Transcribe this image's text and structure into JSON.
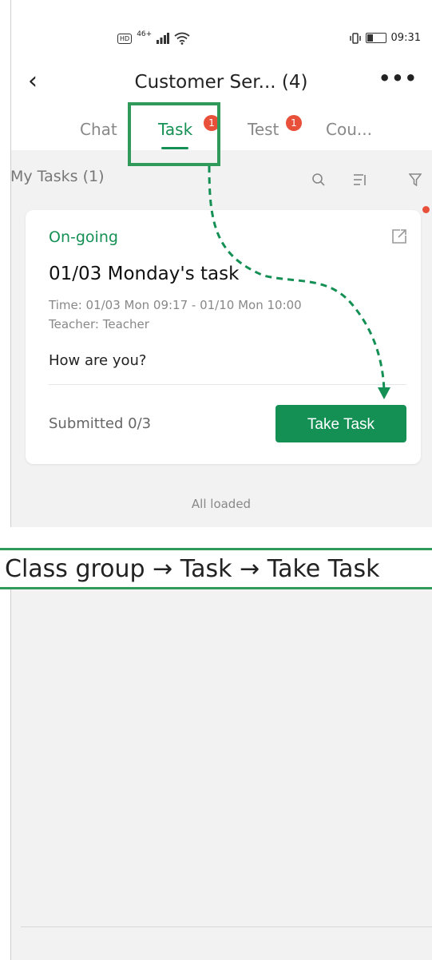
{
  "status_bar": {
    "hd": "HD",
    "network": "46+",
    "time": "09:31"
  },
  "nav": {
    "title": "Customer Ser... (4)",
    "more": "•••"
  },
  "tabs": [
    {
      "label": "Chat"
    },
    {
      "label": "Task",
      "badge": "1"
    },
    {
      "label": "Test",
      "badge": "1"
    },
    {
      "label": "Cou..."
    }
  ],
  "tasks": {
    "label": "My Tasks (1)",
    "card": {
      "status": "On-going",
      "title": "01/03 Monday's task",
      "time": "Time:  01/03 Mon 09:17 - 01/10 Mon 10:00",
      "teacher": "Teacher:  Teacher",
      "description": "How are you?",
      "submitted": "Submitted 0/3",
      "action": "Take Task"
    },
    "footer": "All loaded"
  },
  "caption": "Class group → Task → Take Task",
  "colors": {
    "accent": "#159055",
    "badge": "#e9503a",
    "highlight": "#2f9a59"
  }
}
